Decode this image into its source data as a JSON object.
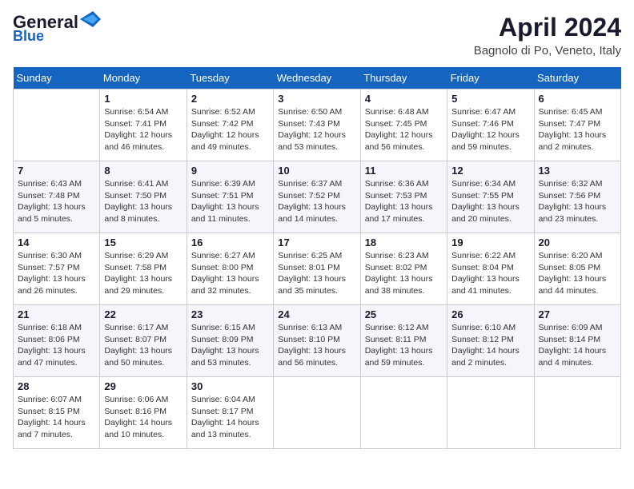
{
  "header": {
    "logo_line1": "General",
    "logo_line2": "Blue",
    "month": "April 2024",
    "location": "Bagnolo di Po, Veneto, Italy"
  },
  "days_of_week": [
    "Sunday",
    "Monday",
    "Tuesday",
    "Wednesday",
    "Thursday",
    "Friday",
    "Saturday"
  ],
  "weeks": [
    [
      {
        "day": "",
        "info": ""
      },
      {
        "day": "1",
        "info": "Sunrise: 6:54 AM\nSunset: 7:41 PM\nDaylight: 12 hours\nand 46 minutes."
      },
      {
        "day": "2",
        "info": "Sunrise: 6:52 AM\nSunset: 7:42 PM\nDaylight: 12 hours\nand 49 minutes."
      },
      {
        "day": "3",
        "info": "Sunrise: 6:50 AM\nSunset: 7:43 PM\nDaylight: 12 hours\nand 53 minutes."
      },
      {
        "day": "4",
        "info": "Sunrise: 6:48 AM\nSunset: 7:45 PM\nDaylight: 12 hours\nand 56 minutes."
      },
      {
        "day": "5",
        "info": "Sunrise: 6:47 AM\nSunset: 7:46 PM\nDaylight: 12 hours\nand 59 minutes."
      },
      {
        "day": "6",
        "info": "Sunrise: 6:45 AM\nSunset: 7:47 PM\nDaylight: 13 hours\nand 2 minutes."
      }
    ],
    [
      {
        "day": "7",
        "info": "Sunrise: 6:43 AM\nSunset: 7:48 PM\nDaylight: 13 hours\nand 5 minutes."
      },
      {
        "day": "8",
        "info": "Sunrise: 6:41 AM\nSunset: 7:50 PM\nDaylight: 13 hours\nand 8 minutes."
      },
      {
        "day": "9",
        "info": "Sunrise: 6:39 AM\nSunset: 7:51 PM\nDaylight: 13 hours\nand 11 minutes."
      },
      {
        "day": "10",
        "info": "Sunrise: 6:37 AM\nSunset: 7:52 PM\nDaylight: 13 hours\nand 14 minutes."
      },
      {
        "day": "11",
        "info": "Sunrise: 6:36 AM\nSunset: 7:53 PM\nDaylight: 13 hours\nand 17 minutes."
      },
      {
        "day": "12",
        "info": "Sunrise: 6:34 AM\nSunset: 7:55 PM\nDaylight: 13 hours\nand 20 minutes."
      },
      {
        "day": "13",
        "info": "Sunrise: 6:32 AM\nSunset: 7:56 PM\nDaylight: 13 hours\nand 23 minutes."
      }
    ],
    [
      {
        "day": "14",
        "info": "Sunrise: 6:30 AM\nSunset: 7:57 PM\nDaylight: 13 hours\nand 26 minutes."
      },
      {
        "day": "15",
        "info": "Sunrise: 6:29 AM\nSunset: 7:58 PM\nDaylight: 13 hours\nand 29 minutes."
      },
      {
        "day": "16",
        "info": "Sunrise: 6:27 AM\nSunset: 8:00 PM\nDaylight: 13 hours\nand 32 minutes."
      },
      {
        "day": "17",
        "info": "Sunrise: 6:25 AM\nSunset: 8:01 PM\nDaylight: 13 hours\nand 35 minutes."
      },
      {
        "day": "18",
        "info": "Sunrise: 6:23 AM\nSunset: 8:02 PM\nDaylight: 13 hours\nand 38 minutes."
      },
      {
        "day": "19",
        "info": "Sunrise: 6:22 AM\nSunset: 8:04 PM\nDaylight: 13 hours\nand 41 minutes."
      },
      {
        "day": "20",
        "info": "Sunrise: 6:20 AM\nSunset: 8:05 PM\nDaylight: 13 hours\nand 44 minutes."
      }
    ],
    [
      {
        "day": "21",
        "info": "Sunrise: 6:18 AM\nSunset: 8:06 PM\nDaylight: 13 hours\nand 47 minutes."
      },
      {
        "day": "22",
        "info": "Sunrise: 6:17 AM\nSunset: 8:07 PM\nDaylight: 13 hours\nand 50 minutes."
      },
      {
        "day": "23",
        "info": "Sunrise: 6:15 AM\nSunset: 8:09 PM\nDaylight: 13 hours\nand 53 minutes."
      },
      {
        "day": "24",
        "info": "Sunrise: 6:13 AM\nSunset: 8:10 PM\nDaylight: 13 hours\nand 56 minutes."
      },
      {
        "day": "25",
        "info": "Sunrise: 6:12 AM\nSunset: 8:11 PM\nDaylight: 13 hours\nand 59 minutes."
      },
      {
        "day": "26",
        "info": "Sunrise: 6:10 AM\nSunset: 8:12 PM\nDaylight: 14 hours\nand 2 minutes."
      },
      {
        "day": "27",
        "info": "Sunrise: 6:09 AM\nSunset: 8:14 PM\nDaylight: 14 hours\nand 4 minutes."
      }
    ],
    [
      {
        "day": "28",
        "info": "Sunrise: 6:07 AM\nSunset: 8:15 PM\nDaylight: 14 hours\nand 7 minutes."
      },
      {
        "day": "29",
        "info": "Sunrise: 6:06 AM\nSunset: 8:16 PM\nDaylight: 14 hours\nand 10 minutes."
      },
      {
        "day": "30",
        "info": "Sunrise: 6:04 AM\nSunset: 8:17 PM\nDaylight: 14 hours\nand 13 minutes."
      },
      {
        "day": "",
        "info": ""
      },
      {
        "day": "",
        "info": ""
      },
      {
        "day": "",
        "info": ""
      },
      {
        "day": "",
        "info": ""
      }
    ]
  ]
}
